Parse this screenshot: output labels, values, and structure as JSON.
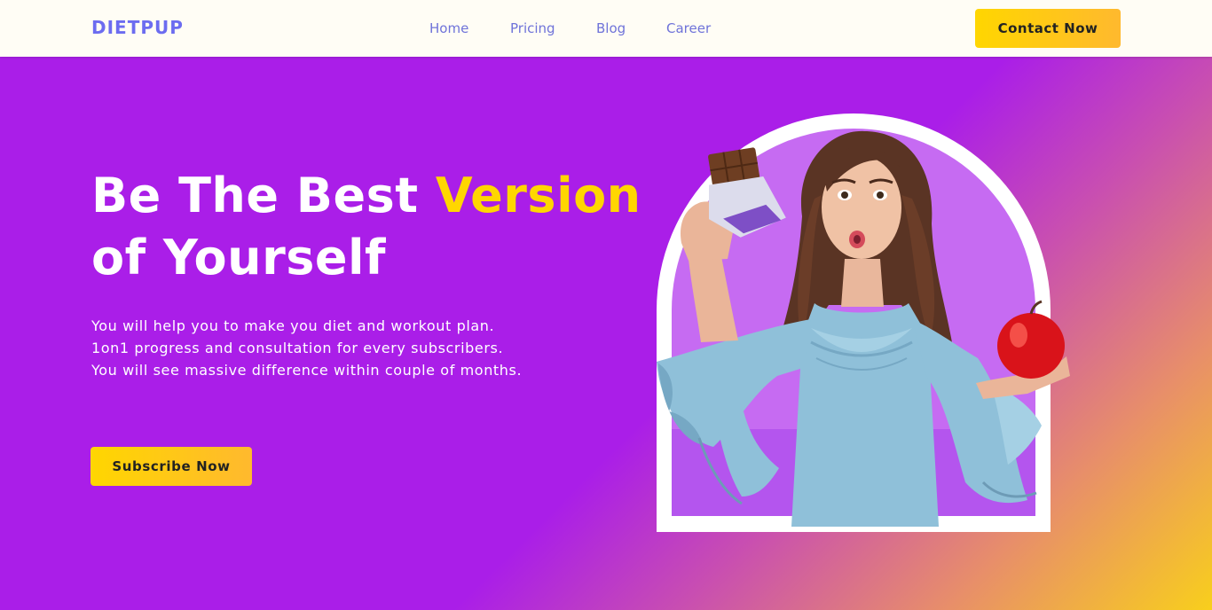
{
  "nav": {
    "logo": "DIETPUP",
    "links": [
      "Home",
      "Pricing",
      "Blog",
      "Career"
    ],
    "contact_label": "Contact Now"
  },
  "hero": {
    "title_part1": "Be The Best ",
    "title_highlight": "Version",
    "title_part2": "of Yourself",
    "description": "You will help you to make you diet and workout plan. 1on1 progress and consultation for every subscribers. You will see massive difference within couple of months.",
    "subscribe_label": "Subscribe Now"
  },
  "colors": {
    "brand": "#6c6cf0",
    "hero_purple": "#aa1ee8",
    "accent_yellow": "#ffd600",
    "dress_blue": "#8fc0d9"
  },
  "icons": [
    "woman-with-chocolate-and-apple-image"
  ]
}
